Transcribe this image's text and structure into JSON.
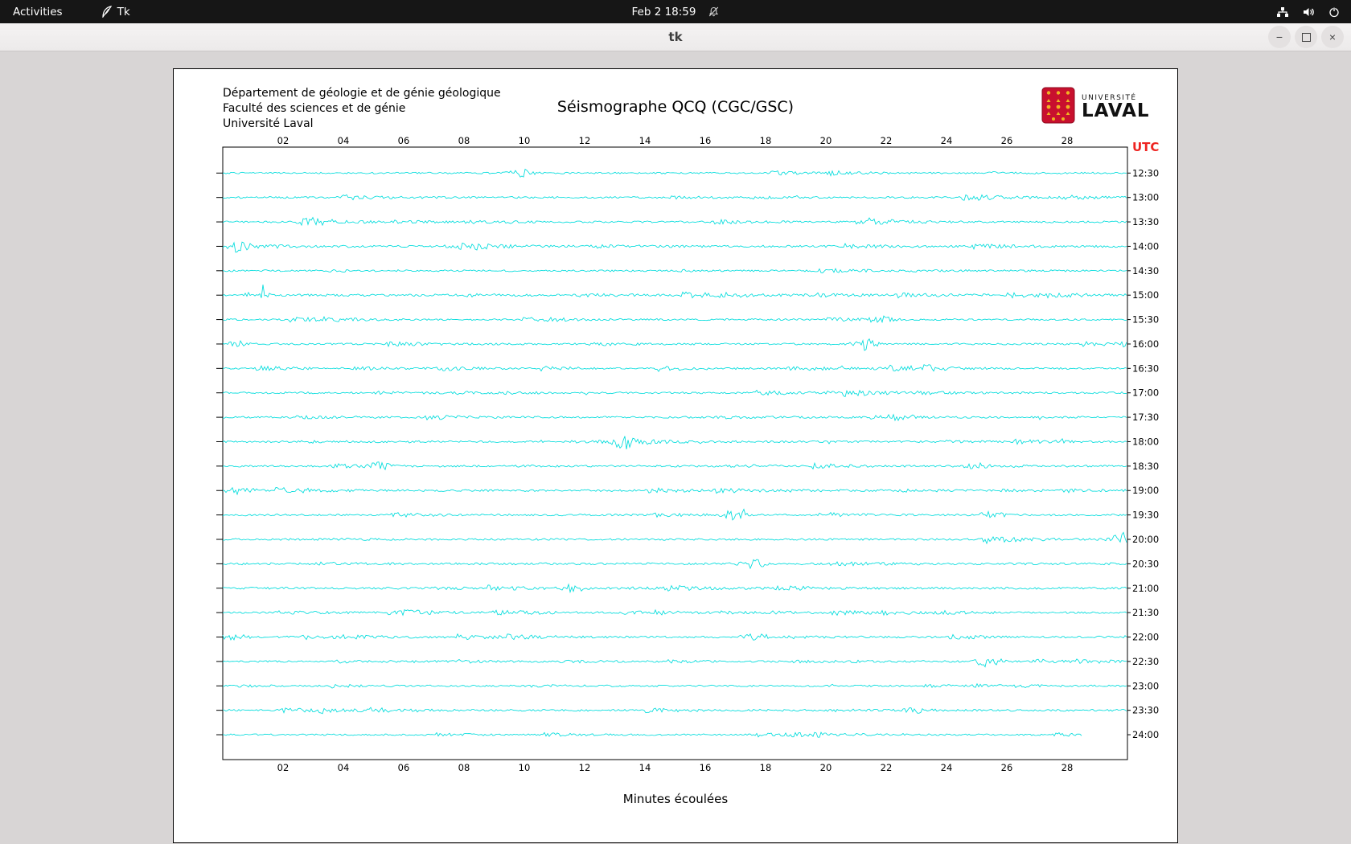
{
  "top_bar": {
    "activities": "Activities",
    "app_name": "Tk",
    "clock": "Feb 2 18:59"
  },
  "window": {
    "title": "tk"
  },
  "header": {
    "address_lines": [
      "Département de géologie et de génie géologique",
      "Faculté des sciences et de génie",
      "Université Laval"
    ],
    "logo": {
      "top": "UNIVERSITÉ",
      "bottom": "LAVAL",
      "shield_red": "#c8102e",
      "shield_gold": "#f0b323"
    }
  },
  "chart_data": {
    "type": "line",
    "title": "Séismographe QCQ (CGC/GSC)",
    "xlabel": "Minutes écoulées",
    "utc_label": "UTC",
    "utc_label_color": "#ee2421",
    "trace_color": "#00dcdc",
    "x_range_minutes": [
      0,
      30
    ],
    "x_ticks": [
      "02",
      "04",
      "06",
      "08",
      "10",
      "12",
      "14",
      "16",
      "18",
      "20",
      "22",
      "24",
      "26",
      "28"
    ],
    "traces": [
      {
        "utc": "12:30",
        "seed": 101,
        "activity": 0.9,
        "end_minute": 30,
        "events": [
          {
            "minute": 9.9,
            "amp": 4.5
          }
        ]
      },
      {
        "utc": "13:00",
        "seed": 102,
        "activity": 1.0,
        "end_minute": 30,
        "events": []
      },
      {
        "utc": "13:30",
        "seed": 103,
        "activity": 1.0,
        "end_minute": 30,
        "events": [
          {
            "minute": 2.9,
            "amp": 3
          }
        ]
      },
      {
        "utc": "14:00",
        "seed": 104,
        "activity": 1.15,
        "end_minute": 30,
        "events": [
          {
            "minute": 0.5,
            "amp": 4
          },
          {
            "minute": 8.2,
            "amp": 4
          }
        ]
      },
      {
        "utc": "14:30",
        "seed": 105,
        "activity": 1.0,
        "end_minute": 30,
        "events": []
      },
      {
        "utc": "15:00",
        "seed": 106,
        "activity": 1.25,
        "end_minute": 30,
        "events": [
          {
            "minute": 1.2,
            "amp": 5
          }
        ]
      },
      {
        "utc": "15:30",
        "seed": 107,
        "activity": 0.95,
        "end_minute": 30,
        "events": [
          {
            "minute": 21.8,
            "amp": 4
          }
        ]
      },
      {
        "utc": "16:00",
        "seed": 108,
        "activity": 1.0,
        "end_minute": 30,
        "events": [
          {
            "minute": 0.3,
            "amp": 5
          },
          {
            "minute": 21.3,
            "amp": 7
          }
        ]
      },
      {
        "utc": "16:30",
        "seed": 109,
        "activity": 0.95,
        "end_minute": 30,
        "events": [
          {
            "minute": 23.3,
            "amp": 4
          }
        ]
      },
      {
        "utc": "17:00",
        "seed": 110,
        "activity": 1.0,
        "end_minute": 30,
        "events": [
          {
            "minute": 20.5,
            "amp": 4
          }
        ]
      },
      {
        "utc": "17:30",
        "seed": 111,
        "activity": 1.05,
        "end_minute": 30,
        "events": [
          {
            "minute": 22.5,
            "amp": 4
          }
        ]
      },
      {
        "utc": "18:00",
        "seed": 112,
        "activity": 1.0,
        "end_minute": 30,
        "events": [
          {
            "minute": 13.3,
            "amp": 9
          }
        ]
      },
      {
        "utc": "18:30",
        "seed": 113,
        "activity": 1.0,
        "end_minute": 30,
        "events": [
          {
            "minute": 5.2,
            "amp": 4
          },
          {
            "minute": 25.0,
            "amp": 4
          }
        ]
      },
      {
        "utc": "19:00",
        "seed": 114,
        "activity": 1.1,
        "end_minute": 30,
        "events": [
          {
            "minute": 0.5,
            "amp": 4
          }
        ]
      },
      {
        "utc": "19:30",
        "seed": 115,
        "activity": 1.0,
        "end_minute": 30,
        "events": [
          {
            "minute": 16.9,
            "amp": 6
          },
          {
            "minute": 25.5,
            "amp": 5
          }
        ]
      },
      {
        "utc": "20:00",
        "seed": 116,
        "activity": 1.05,
        "end_minute": 30,
        "events": [
          {
            "minute": 29.9,
            "amp": 8
          }
        ]
      },
      {
        "utc": "20:30",
        "seed": 117,
        "activity": 1.15,
        "end_minute": 30,
        "events": [
          {
            "minute": 17.6,
            "amp": 5
          }
        ]
      },
      {
        "utc": "21:00",
        "seed": 118,
        "activity": 1.1,
        "end_minute": 30,
        "events": [
          {
            "minute": 11.6,
            "amp": 4
          }
        ]
      },
      {
        "utc": "21:30",
        "seed": 119,
        "activity": 0.95,
        "end_minute": 30,
        "events": []
      },
      {
        "utc": "22:00",
        "seed": 120,
        "activity": 1.05,
        "end_minute": 30,
        "events": [
          {
            "minute": 0.4,
            "amp": 4
          }
        ]
      },
      {
        "utc": "22:30",
        "seed": 121,
        "activity": 0.95,
        "end_minute": 30,
        "events": [
          {
            "minute": 25.4,
            "amp": 6
          }
        ]
      },
      {
        "utc": "23:00",
        "seed": 122,
        "activity": 0.9,
        "end_minute": 30,
        "events": []
      },
      {
        "utc": "23:30",
        "seed": 123,
        "activity": 1.0,
        "end_minute": 30,
        "events": [
          {
            "minute": 23.0,
            "amp": 4
          }
        ]
      },
      {
        "utc": "24:00",
        "seed": 124,
        "activity": 0.9,
        "end_minute": 28.5,
        "events": []
      }
    ]
  }
}
